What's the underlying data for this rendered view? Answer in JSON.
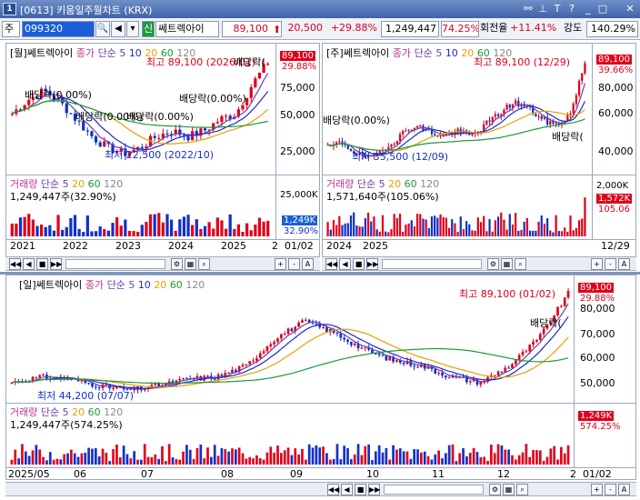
{
  "window": {
    "number": "1",
    "title": "[0613] 키움일주월차트 (KRX)"
  },
  "toolbar": {
    "market": "주",
    "code": "099320",
    "badge": "신",
    "name": "쎄트렉아이",
    "price": "89,100",
    "change": "20,500",
    "rate": "+29.88%",
    "volume": "1,249,447",
    "turnover_ratio": "74.25%",
    "turnover_label": "회전율",
    "turnover_change": "+11.41%",
    "strength_label": "강도",
    "strength": "140.29%"
  },
  "monthly": {
    "header": {
      "tag": "[월]",
      "name": "쎄트렉아이",
      "price_type": "종가",
      "ma_label": "단순",
      "ma": [
        "5",
        "10",
        "20",
        "60",
        "120"
      ]
    },
    "price_box": "89,100",
    "rate_box": "29.88%",
    "y_ticks": [
      "75,000",
      "50,000",
      "25,000"
    ],
    "high_note": "최고 89,100 (2026/01)",
    "low_note": "최저 22,500 (2022/10)",
    "dividends": [
      "배당락(0.00%)",
      "배당락(0.00%)",
      "배당락(0.00%)",
      "배당락(0.00%)",
      "배당락("
    ],
    "volume_header": {
      "title": "거래량",
      "ma_label": "단순",
      "ma": [
        "5",
        "20",
        "60",
        "120"
      ]
    },
    "volume_text": "1,249,447주(32.90%)",
    "vol_ticks": [
      "25,000K"
    ],
    "vol_box": "1,249K",
    "vol_rate": "32.90%",
    "x_ticks": [
      "2021",
      "2022",
      "2023",
      "2024",
      "2025",
      "2"
    ],
    "date": "01/02"
  },
  "weekly": {
    "header": {
      "tag": "[주]",
      "name": "쎄트렉아이",
      "price_type": "종가",
      "ma_label": "단순",
      "ma": [
        "5",
        "10",
        "20",
        "60",
        "120"
      ]
    },
    "price_box": "89,100",
    "rate_box": "39.66%",
    "y_ticks": [
      "80,000",
      "60,000",
      "40,000"
    ],
    "high_note": "최고 89,100 (12/29)",
    "low_note": "최저 35,500 (12/09)",
    "dividends": [
      "배당락(0.00%)",
      "배당락("
    ],
    "volume_header": {
      "title": "거래량",
      "ma_label": "단순",
      "ma": [
        "5",
        "20",
        "60",
        "120"
      ]
    },
    "volume_text": "1,571,640주(105.06%)",
    "vol_ticks": [
      "2,000K"
    ],
    "vol_box": "1,572K",
    "vol_rate": "105.06",
    "x_ticks": [
      "2024",
      "2025"
    ],
    "date": "12/29"
  },
  "daily": {
    "header": {
      "tag": "[일]",
      "name": "쎄트렉아이",
      "price_type": "종가",
      "ma_label": "단순",
      "ma": [
        "5",
        "10",
        "20",
        "60",
        "120"
      ]
    },
    "price_box": "89,100",
    "rate_box": "29.88%",
    "y_ticks": [
      "80,000",
      "70,000",
      "60,000",
      "50,000"
    ],
    "high_note": "최고 89,100 (01/02)",
    "low_note": "최저 44,200 (07/07)",
    "dividends": [
      "배당락("
    ],
    "volume_header": {
      "title": "거래량",
      "ma_label": "단순",
      "ma": [
        "5",
        "20",
        "60",
        "120"
      ]
    },
    "volume_text": "1,249,447주(574.25%)",
    "vol_box": "1,249K",
    "vol_rate": "574.25%",
    "x_ticks": [
      "2025/05",
      "06",
      "07",
      "08",
      "09",
      "10",
      "11",
      "12",
      "2"
    ],
    "date": "01/02"
  },
  "controls": [
    "◀◀",
    "◀",
    "■",
    "▶▶",
    "+",
    "-",
    "A"
  ],
  "colors": {
    "up": "#e0001a",
    "down": "#1230c8",
    "ma5": "#6a3fb0",
    "ma10": "#1a2cc8",
    "ma20": "#e8a000",
    "ma60": "#1a9a3a",
    "ma120": "#888888"
  }
}
